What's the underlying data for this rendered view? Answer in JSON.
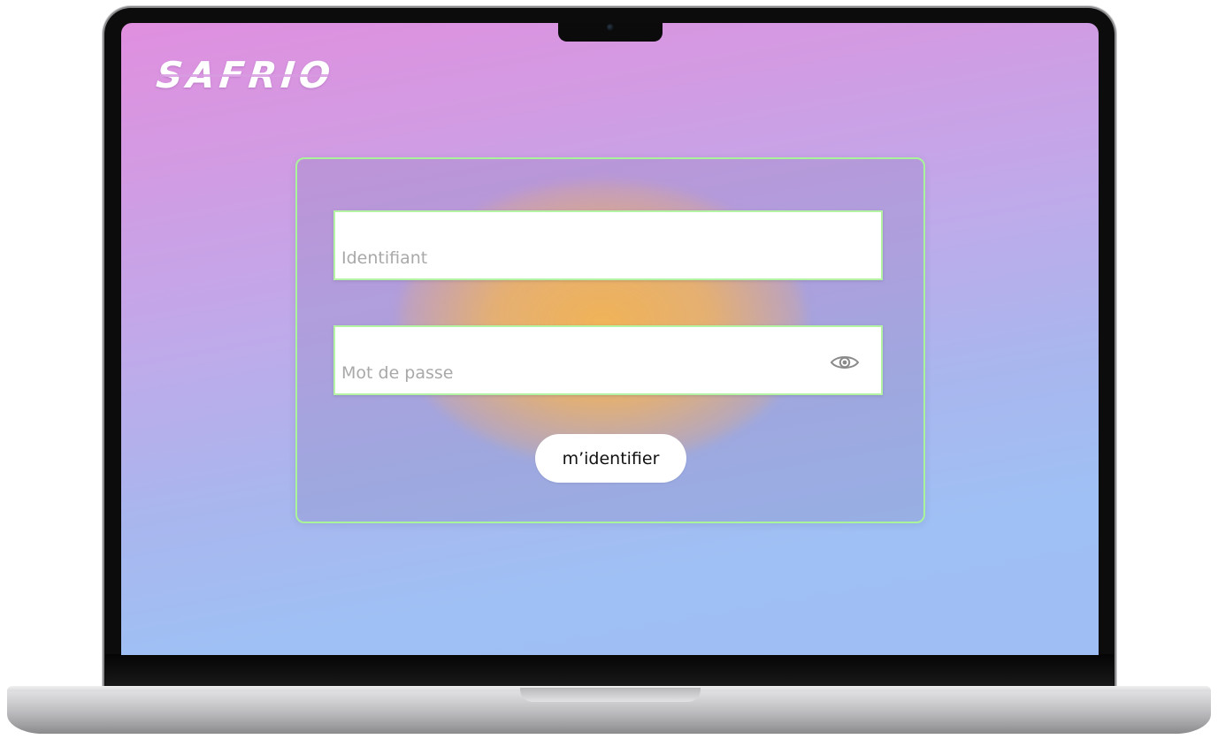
{
  "app": {
    "logo_text": "SAFRIO"
  },
  "login_form": {
    "identifier_placeholder": "Identifiant",
    "identifier_value": "",
    "password_placeholder": "Mot de passe",
    "password_value": "",
    "show_password_icon": "eye-icon",
    "submit_label": "m’identifier"
  },
  "colors": {
    "accent_border": "#a9f39a",
    "background_top": "#e08fdf",
    "background_bottom": "#9fbef3",
    "glow": "#f4b450",
    "button_background": "#ffffff"
  }
}
